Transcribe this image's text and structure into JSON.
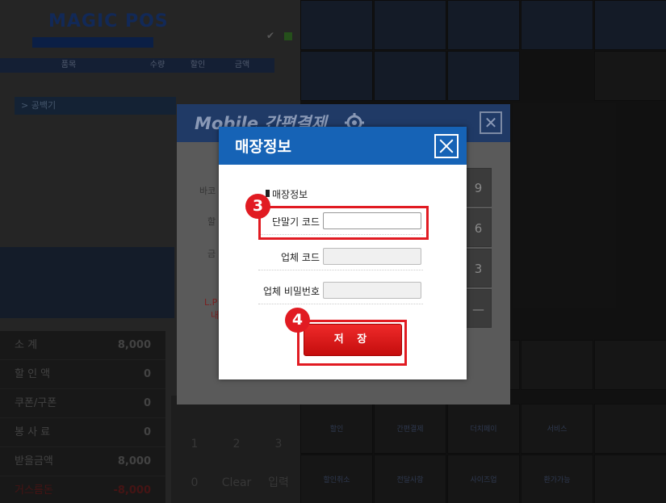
{
  "background_pos": {
    "logo": "MAGIC POS",
    "order_header": [
      "품목",
      "수량",
      "할인",
      "금액"
    ],
    "order_item_label": "> 공백기",
    "totals": [
      {
        "label": "소 계",
        "value": "8,000"
      },
      {
        "label": "할 인 액",
        "value": "0"
      },
      {
        "label": "쿠폰/구폰",
        "value": "0"
      },
      {
        "label": "봉 사 료",
        "value": "0"
      },
      {
        "label": "받을금액",
        "value": "8,000"
      },
      {
        "label": "거스름돈",
        "value": "-8,000"
      }
    ],
    "keypad": [
      "1",
      "2",
      "3",
      "0",
      "Clear",
      "입력"
    ],
    "grid_buttons": [
      "할인",
      "간편결제",
      "더치페이",
      "서비스",
      "할인취소",
      "전달사항",
      "사이즈업",
      "환가가능"
    ]
  },
  "mobile_dialog": {
    "title": "Mobile 간편결제",
    "labels": [
      "바코",
      "할",
      "금",
      "L.P",
      "내"
    ],
    "number_keys": [
      "9",
      "6",
      "3"
    ]
  },
  "store_dialog": {
    "title": "매장정보",
    "section_title": "매장정보",
    "fields": [
      {
        "label": "단말기 코드",
        "value": "",
        "enabled": true
      },
      {
        "label": "업체 코드",
        "value": "",
        "enabled": false
      },
      {
        "label": "업체 비밀번호",
        "value": "",
        "enabled": false
      }
    ],
    "save_label": "저 장"
  },
  "callouts": [
    {
      "number": "3",
      "target": "단말기 코드"
    },
    {
      "number": "4",
      "target": "저 장"
    }
  ],
  "colors": {
    "header_blue": "#1663b6",
    "accent_red": "#e11b22",
    "save_red": "#d81515"
  }
}
